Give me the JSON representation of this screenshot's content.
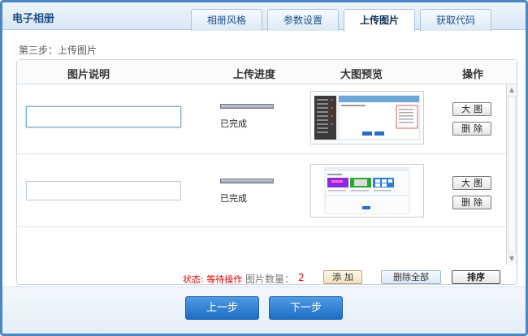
{
  "app_title": "电子相册",
  "tabs": [
    "相册风格",
    "参数设置",
    "上传图片",
    "获取代码"
  ],
  "active_tab": "上传图片",
  "step_label": "第三步：上传图片",
  "table": {
    "headers": [
      "图片说明",
      "上传进度",
      "大图预览",
      "操作"
    ],
    "rows": [
      {
        "description": "",
        "progress": 1.0,
        "status": "已完成",
        "btn_view": "大图",
        "btn_delete": "删除"
      },
      {
        "description": "",
        "progress": 1.0,
        "status": "已完成",
        "btn_view": "大图",
        "btn_delete": "删除"
      }
    ]
  },
  "bottom": {
    "state": "状态: 等待操作",
    "count_label": "图片数量：",
    "count_value": "2",
    "add_label": "添加",
    "delete_all_label": "删除全部",
    "sort_label": "排序"
  },
  "nav": {
    "prev": "上一步",
    "next": "下一步"
  },
  "colors": {
    "accent": "#1f6cc4",
    "border": "#4a86c6",
    "status_red": "#dd0000"
  }
}
